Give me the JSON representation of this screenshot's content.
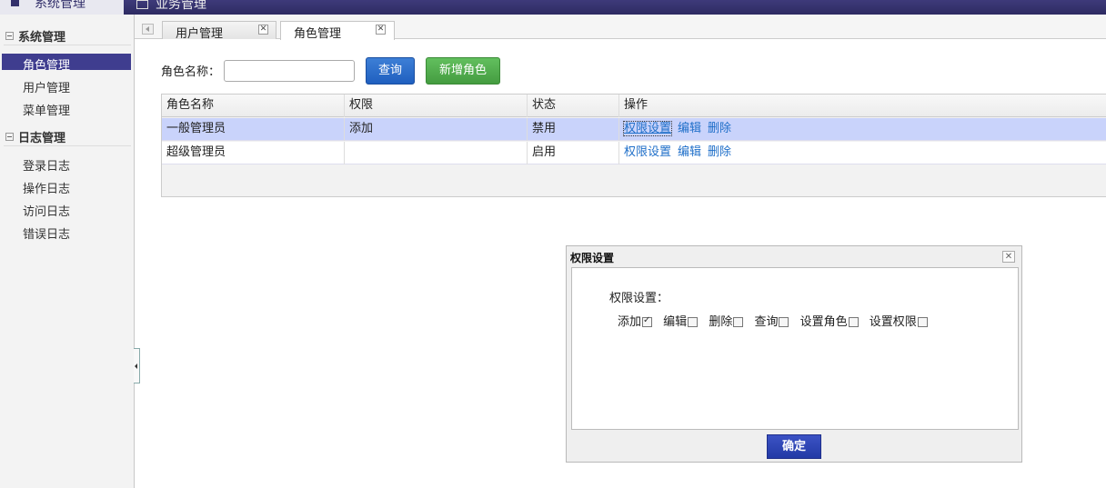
{
  "topbar": {
    "active_module": "系统管理",
    "other_module": "业务管理"
  },
  "sidebar": {
    "groups": [
      {
        "label": "系统管理",
        "items": [
          "角色管理",
          "用户管理",
          "菜单管理"
        ]
      },
      {
        "label": "日志管理",
        "items": [
          "登录日志",
          "操作日志",
          "访问日志",
          "错误日志"
        ]
      }
    ],
    "active_item": "角色管理"
  },
  "tabs": [
    {
      "label": "用户管理"
    },
    {
      "label": "角色管理"
    }
  ],
  "search": {
    "label": "角色名称：",
    "value": "",
    "query_button": "查询",
    "add_button": "新增角色"
  },
  "grid": {
    "columns": [
      "角色名称",
      "权限",
      "状态",
      "操作"
    ],
    "rows": [
      {
        "name": "一般管理员",
        "permission": "添加",
        "status": "禁用",
        "actions": [
          "权限设置",
          "编辑",
          "删除"
        ]
      },
      {
        "name": "超级管理员",
        "permission": "",
        "status": "启用",
        "actions": [
          "权限设置",
          "编辑",
          "删除"
        ]
      }
    ]
  },
  "dialog": {
    "title": "权限设置",
    "label": "权限设置：",
    "permissions": [
      {
        "label": "添加",
        "checked": true
      },
      {
        "label": "编辑",
        "checked": false
      },
      {
        "label": "删除",
        "checked": false
      },
      {
        "label": "查询",
        "checked": false
      },
      {
        "label": "设置角色",
        "checked": false
      },
      {
        "label": "设置权限",
        "checked": false
      }
    ],
    "ok_button": "确定"
  },
  "colors": {
    "topbar": "#2e2b62",
    "sidebar_active": "#3f3d8f",
    "query_button": "#1f5fbf",
    "add_button": "#449c40",
    "selected_row": "#c9d3fb",
    "link": "#1f6fc9"
  }
}
